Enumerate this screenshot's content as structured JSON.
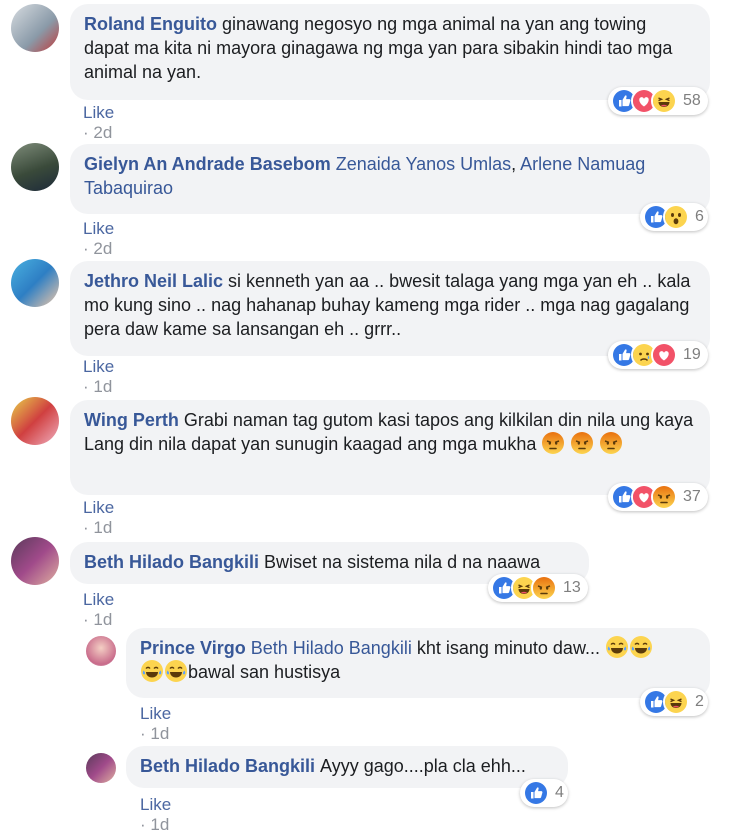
{
  "comments": [
    {
      "author": "Roland Enguito",
      "text": "ginawang negosyo ng mga animal na yan ang towing dapat ma kita ni mayora ginagawa ng mga yan para sibakin hindi tao mga animal na yan.",
      "like_label": "Like",
      "time": "2d",
      "reactions": [
        "like-icon",
        "love-icon",
        "haha-icon"
      ],
      "reaction_count": "58"
    },
    {
      "author": "Gielyn An Andrade Basebom",
      "tags": [
        "Zenaida Yanos Umlas",
        "Arlene Namuag Tabaquirao"
      ],
      "like_label": "Like",
      "time": "2d",
      "reactions": [
        "like-icon",
        "wow-icon"
      ],
      "reaction_count": "6"
    },
    {
      "author": "Jethro Neil Lalic",
      "text": "si kenneth yan aa .. bwesit talaga yang mga yan eh .. kala mo kung sino .. nag hahanap buhay kameng mga rider .. mga nag gagalang pera daw kame sa lansangan eh .. grrr..",
      "like_label": "Like",
      "time": "1d",
      "reactions": [
        "like-icon",
        "sad-icon",
        "love-icon"
      ],
      "reaction_count": "19"
    },
    {
      "author": "Wing Perth",
      "text": "Grabi naman tag gutom kasi tapos ang kilkilan din nila ung kaya Lang din nila dapat yan sunugin kaagad ang mga mukha",
      "inline_emojis": [
        "angry-emoji",
        "angry-emoji",
        "angry-emoji"
      ],
      "like_label": "Like",
      "time": "1d",
      "reactions": [
        "like-icon",
        "love-icon",
        "angry-icon"
      ],
      "reaction_count": "37"
    },
    {
      "author": "Beth Hilado Bangkili",
      "text": "Bwiset na sistema nila d na naawa",
      "like_label": "Like",
      "time": "1d",
      "reactions": [
        "like-icon",
        "haha-icon",
        "angry-icon"
      ],
      "reaction_count": "13"
    }
  ],
  "replies": [
    {
      "author": "Prince Virgo",
      "tag": "Beth Hilado Bangkili",
      "text_a": "kht isang minuto daw...",
      "text_b": "bawal san hustisya",
      "inline_emojis": [
        "tears-of-joy-emoji",
        "tears-of-joy-emoji",
        "tears-of-joy-emoji",
        "tears-of-joy-emoji"
      ],
      "like_label": "Like",
      "time": "1d",
      "reactions": [
        "like-icon",
        "haha-icon"
      ],
      "reaction_count": "2"
    },
    {
      "author": "Beth Hilado Bangkili",
      "text": "Ayyy gago....pla cla ehh...",
      "like_label": "Like",
      "time": "1d",
      "reactions": [
        "like-icon"
      ],
      "reaction_count": "4"
    }
  ],
  "colors": {
    "author": "#385898",
    "bubble": "#f2f3f5",
    "meta": "#90949c",
    "like_blue": "#3578e5",
    "love_red": "#f25268",
    "emoji_yellow": "#fcd44f",
    "angry_orange": "#e9710f"
  }
}
